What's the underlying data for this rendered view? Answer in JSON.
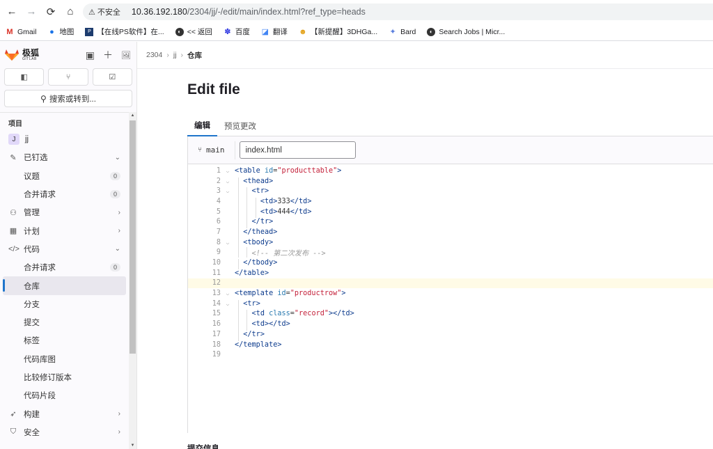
{
  "browser": {
    "insecure_label": "不安全",
    "url_host": "10.36.192.180",
    "url_path": "/2304/jj/-/edit/main/index.html?ref_type=heads",
    "bookmarks": [
      {
        "icon": "gmail-icon",
        "label": "Gmail"
      },
      {
        "icon": "maps-icon",
        "label": "地图"
      },
      {
        "icon": "ps-icon",
        "label": "【在线PS软件】在..."
      },
      {
        "icon": "globe-icon",
        "label": "<< 返回"
      },
      {
        "icon": "baidu-icon",
        "label": "百度"
      },
      {
        "icon": "translate-icon",
        "label": "翻译"
      },
      {
        "icon": "game-icon",
        "label": "【新提醒】3DHGa..."
      },
      {
        "icon": "bard-icon",
        "label": "Bard"
      },
      {
        "icon": "globe-icon",
        "label": "Search Jobs | Micr..."
      }
    ]
  },
  "sidebar": {
    "logo_cn": "极狐",
    "logo_en": "GITLAB",
    "search_label": "搜索或转到...",
    "section_label": "项目",
    "project_initial": "J",
    "project_name": "jj",
    "items": [
      {
        "label": "已钉选",
        "icon": "pin-icon",
        "kind": "group"
      },
      {
        "label": "议题",
        "badge": "0",
        "kind": "sub"
      },
      {
        "label": "合并请求",
        "badge": "0",
        "kind": "sub"
      },
      {
        "label": "管理",
        "icon": "users-icon",
        "kind": "group"
      },
      {
        "label": "计划",
        "icon": "calendar-icon",
        "kind": "group"
      },
      {
        "label": "代码",
        "icon": "code-icon",
        "kind": "group"
      },
      {
        "label": "合并请求",
        "badge": "0",
        "kind": "sub"
      },
      {
        "label": "仓库",
        "kind": "sub-active"
      },
      {
        "label": "分支",
        "kind": "sub"
      },
      {
        "label": "提交",
        "kind": "sub"
      },
      {
        "label": "标签",
        "kind": "sub"
      },
      {
        "label": "代码库图",
        "kind": "sub"
      },
      {
        "label": "比较修订版本",
        "kind": "sub"
      },
      {
        "label": "代码片段",
        "kind": "sub"
      },
      {
        "label": "构建",
        "icon": "rocket-icon",
        "kind": "group"
      },
      {
        "label": "安全",
        "icon": "shield-icon",
        "kind": "group"
      }
    ]
  },
  "breadcrumb": {
    "items": [
      "2304",
      "jj",
      "仓库"
    ]
  },
  "page": {
    "title": "Edit file",
    "tabs": [
      "编辑",
      "预览更改"
    ],
    "branch": "main",
    "filename": "index.html",
    "commit_label": "提交信息"
  },
  "code_lines": [
    "<table id=\"producttable\">",
    "  <thead>",
    "    <tr>",
    "      <td>333</td>",
    "      <td>444</td>",
    "    </tr>",
    "  </thead>",
    "  <tbody>",
    "    <!-- 第二次发布 -->",
    "  </tbody>",
    "</table>",
    "",
    "<template id=\"productrow\">",
    "  <tr>",
    "    <td class=\"record\"></td>",
    "    <td></td>",
    "  </tr>",
    "</template>",
    ""
  ],
  "colors": {
    "accent": "#1f75cb",
    "sidebar_bg": "#fbfafd",
    "highlight_line": "#fffbe6"
  }
}
